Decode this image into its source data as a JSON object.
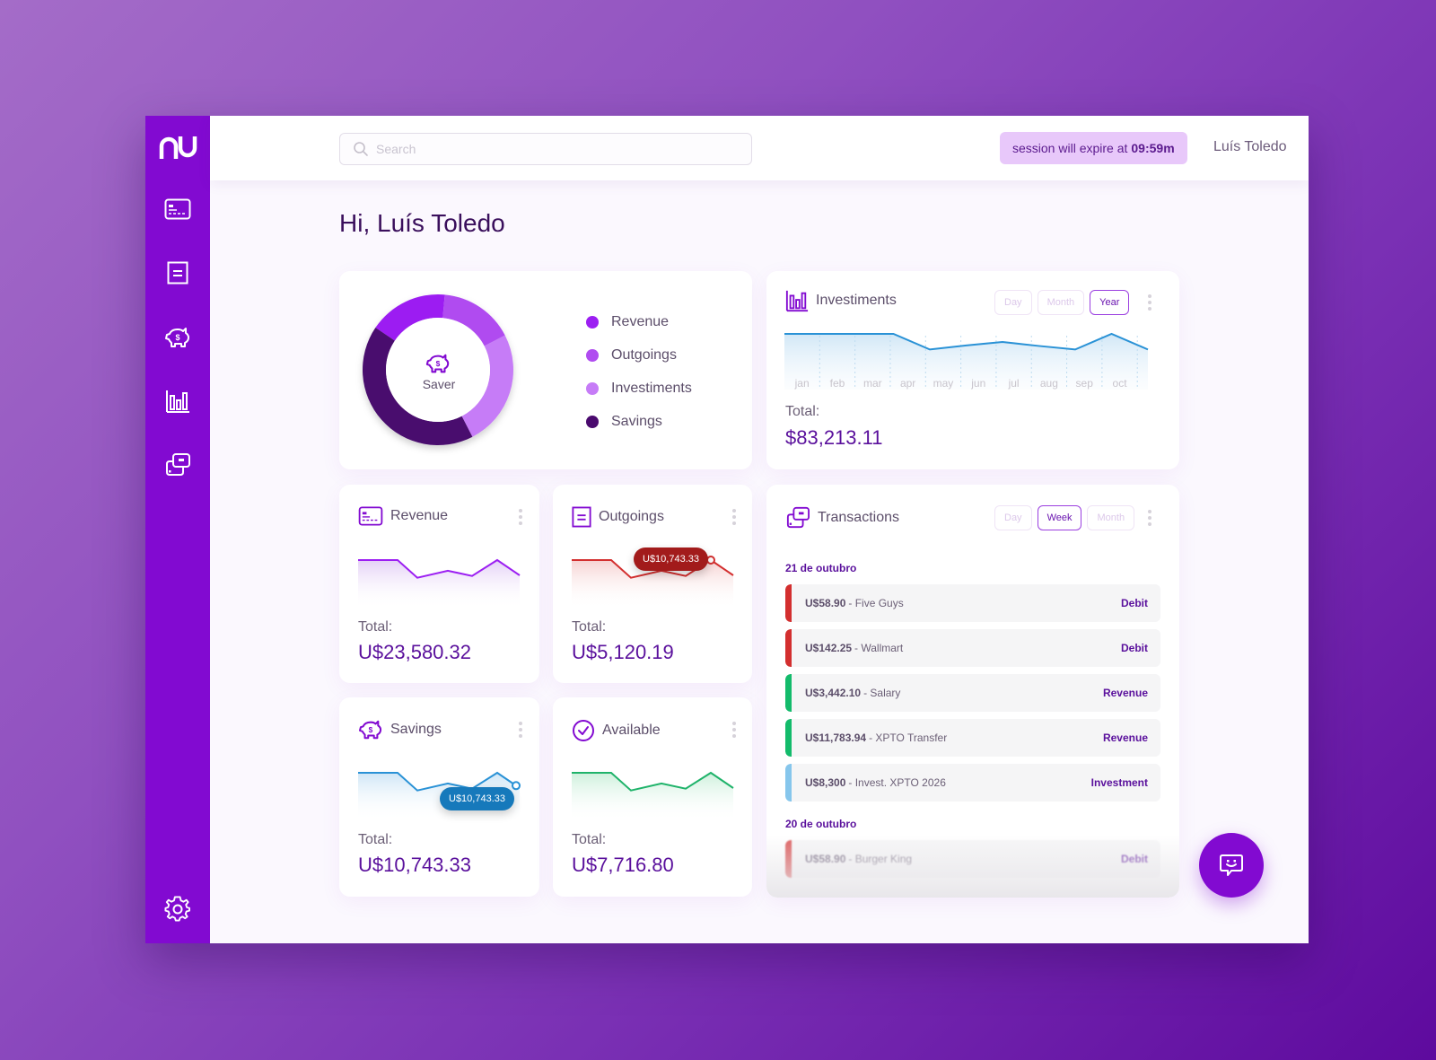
{
  "app": {
    "brand": "nu"
  },
  "colors": {
    "primary": "#820ad1",
    "revenue": "#9c1ff2",
    "outgoings": "#b04cf0",
    "investiments": "#c67cf7",
    "savings": "#4a0a6e",
    "debit": "#d32f2f",
    "credit": "#13bb6b",
    "investment": "#86c6ec"
  },
  "sidebar": {
    "items": [
      {
        "name": "cards",
        "icon": "credit-card-icon"
      },
      {
        "name": "statement",
        "icon": "document-icon"
      },
      {
        "name": "savings",
        "icon": "piggy-bank-icon"
      },
      {
        "name": "investments",
        "icon": "bar-chart-icon"
      },
      {
        "name": "transactions",
        "icon": "transfer-icon"
      }
    ],
    "settings_icon": "gear-icon"
  },
  "header": {
    "search_placeholder": "Search",
    "search_value": "",
    "session_text": "session will expire at",
    "session_time": "09:59m",
    "user_name": "Luís Toledo"
  },
  "greeting": "Hi, Luís Toledo",
  "overview": {
    "center_label": "Saver",
    "chart_data": {
      "type": "pie",
      "title": "Saver",
      "categories": [
        "Revenue",
        "Outgoings",
        "Investiments",
        "Savings"
      ],
      "values": [
        17,
        16,
        25,
        42
      ],
      "colors": [
        "#9c1ff2",
        "#b04cf0",
        "#c67cf7",
        "#4a0a6e"
      ],
      "start_angle_deg": -56,
      "legend": "right"
    }
  },
  "investments": {
    "title": "Investiments",
    "periods": [
      "Day",
      "Month",
      "Year"
    ],
    "active_period": "Year",
    "total_label": "Total:",
    "total_value": "$83,213.11",
    "chart_data": {
      "type": "area",
      "categories": [
        "jan",
        "feb",
        "mar",
        "apr",
        "may",
        "jun",
        "jul",
        "aug",
        "sep",
        "oct"
      ],
      "x": [
        0,
        1,
        2,
        3,
        4,
        5,
        6,
        7,
        8,
        9,
        10
      ],
      "values": [
        100,
        100,
        100,
        100,
        38,
        54,
        68,
        52,
        38,
        100,
        38
      ],
      "ylim": [
        0,
        120
      ],
      "color": "#2a92d6",
      "grid": "vertical-dotted"
    }
  },
  "mini_cards": [
    {
      "key": "revenue",
      "title": "Revenue",
      "icon": "credit-card-icon",
      "total_label": "Total:",
      "total_value": "U$23,580.32",
      "color": "#9c1ff2",
      "fill": "#e4d0f6",
      "chart_data": {
        "type": "area",
        "values": [
          100,
          100,
          42,
          65,
          48,
          100,
          50
        ],
        "ylim": [
          0,
          120
        ]
      },
      "tooltip": null
    },
    {
      "key": "outgoings",
      "title": "Outgoings",
      "icon": "document-icon",
      "total_label": "Total:",
      "total_value": "U$5,120.19",
      "color": "#d32f2f",
      "fill": "#f6d2d2",
      "chart_data": {
        "type": "area",
        "values": [
          100,
          100,
          42,
          65,
          48,
          100,
          50
        ],
        "ylim": [
          0,
          120
        ]
      },
      "tooltip": {
        "text": "U$10,743.33",
        "point_index": 5,
        "bg": "#a21b1b"
      }
    },
    {
      "key": "savings",
      "title": "Savings",
      "icon": "piggy-bank-icon",
      "total_label": "Total:",
      "total_value": "U$10,743.33",
      "color": "#2a92d6",
      "fill": "#cfe6f6",
      "chart_data": {
        "type": "area",
        "values": [
          100,
          100,
          42,
          65,
          48,
          100,
          50
        ],
        "ylim": [
          0,
          120
        ]
      },
      "tooltip": {
        "text": "U$10,743.33",
        "point_index": 6,
        "bg": "#1679bb"
      }
    },
    {
      "key": "available",
      "title": "Available",
      "icon": "check-circle-icon",
      "total_label": "Total:",
      "total_value": "U$7,716.80",
      "color": "#1fb36a",
      "fill": "#cdf0dc",
      "chart_data": {
        "type": "area",
        "values": [
          100,
          100,
          42,
          65,
          48,
          100,
          50
        ],
        "ylim": [
          0,
          120
        ]
      },
      "tooltip": null
    }
  ],
  "transactions": {
    "title": "Transactions",
    "periods": [
      "Day",
      "Week",
      "Month"
    ],
    "active_period": "Week",
    "groups": [
      {
        "date": "21 de outubro",
        "items": [
          {
            "amount": "U$58.90",
            "description": "- Five Guys",
            "type": "Debit",
            "kind": "debit"
          },
          {
            "amount": "U$142.25",
            "description": "- Wallmart",
            "type": "Debit",
            "kind": "debit"
          },
          {
            "amount": "U$3,442.10",
            "description": "- Salary",
            "type": "Revenue",
            "kind": "credit"
          },
          {
            "amount": "U$11,783.94",
            "description": "- XPTO Transfer",
            "type": "Revenue",
            "kind": "credit"
          },
          {
            "amount": "U$8,300",
            "description": "- Invest. XPTO 2026",
            "type": "Investment",
            "kind": "investment"
          }
        ]
      },
      {
        "date": "20 de outubro",
        "items": [
          {
            "amount": "U$58.90",
            "description": "- Burger King",
            "type": "Debit",
            "kind": "debit"
          }
        ]
      }
    ]
  },
  "fab": {
    "icon": "chat-bot-icon"
  }
}
